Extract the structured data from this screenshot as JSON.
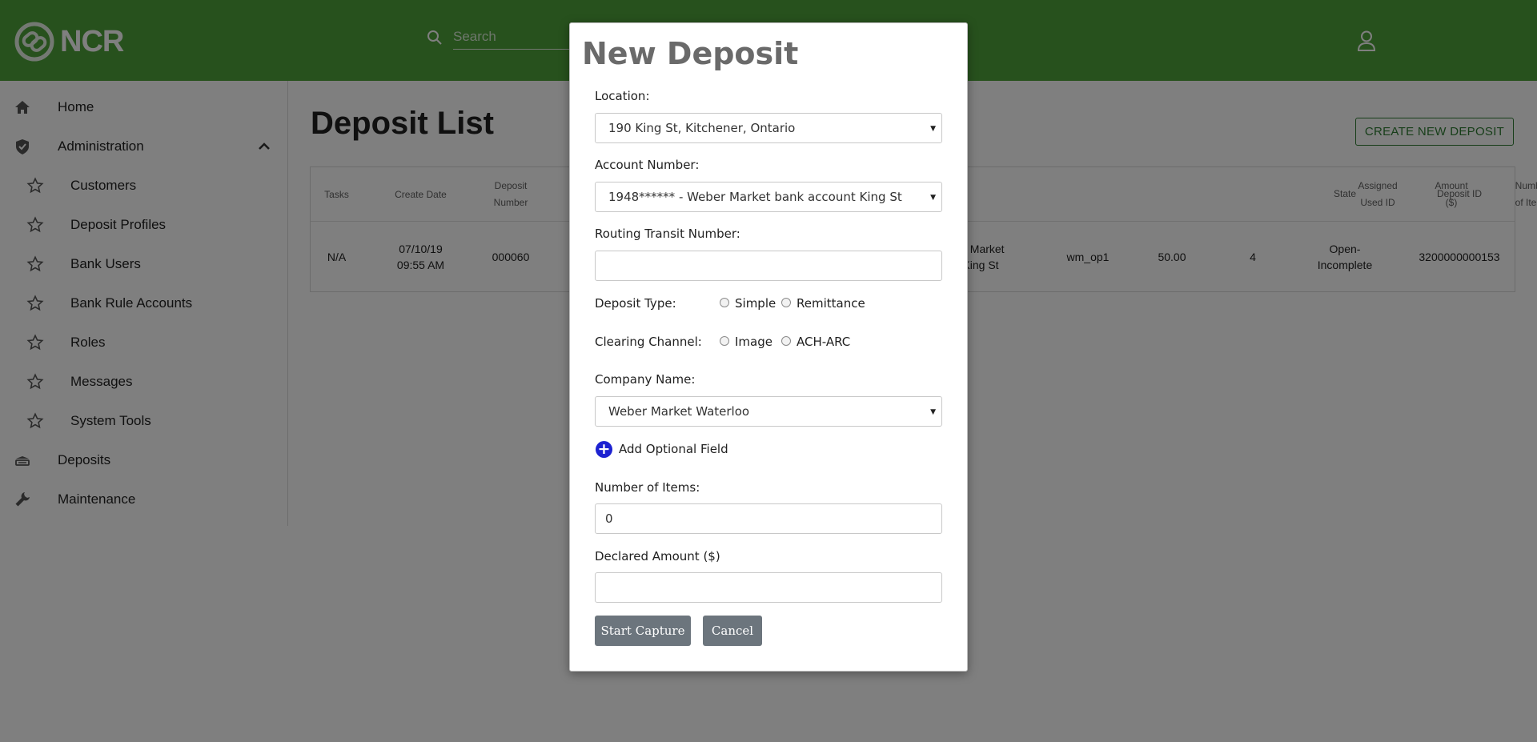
{
  "header": {
    "brand": "NCR",
    "search_placeholder": "Search"
  },
  "sidebar": {
    "items": [
      {
        "label": "Home",
        "icon": "home-icon"
      },
      {
        "label": "Administration",
        "icon": "shield-icon"
      },
      {
        "label": "Customers",
        "icon": "star-icon"
      },
      {
        "label": "Deposit Profiles",
        "icon": "star-icon"
      },
      {
        "label": "Bank Users",
        "icon": "star-icon"
      },
      {
        "label": "Bank Rule Accounts",
        "icon": "star-icon"
      },
      {
        "label": "Roles",
        "icon": "star-icon"
      },
      {
        "label": "Messages",
        "icon": "star-icon"
      },
      {
        "label": "System Tools",
        "icon": "star-icon"
      },
      {
        "label": "Deposits",
        "icon": "deposit-icon"
      },
      {
        "label": "Maintenance",
        "icon": "wrench-icon"
      }
    ]
  },
  "main": {
    "title": "Deposit List",
    "create_label": "CREATE NEW DEPOSIT",
    "table": {
      "headers": [
        "Tasks",
        "Create Date",
        "Deposit Number",
        "Assigned Used ID",
        "Amount ($)",
        "Number of Items",
        "State",
        "Deposit ID"
      ],
      "header_lines": {
        "deposit_number": [
          "Deposit",
          "Number"
        ],
        "assigned": [
          "Assigned",
          "Used ID"
        ],
        "amount": [
          "Amount",
          "($)"
        ],
        "items": [
          "Number",
          "of Items"
        ]
      },
      "row": {
        "tasks": "N/A",
        "date_line1": "07/10/19",
        "date_line2": "09:55 AM",
        "deposit_number": "000060",
        "name_line1": "er Market",
        "name_line2": "King St",
        "assigned": "wm_op1",
        "amount": "50.00",
        "items": "4",
        "state_line1": "Open-",
        "state_line2": "Incomplete",
        "deposit_id": "3200000000153"
      }
    }
  },
  "modal": {
    "title": "New Deposit",
    "location_label": "Location:",
    "location_value": "190 King St, Kitchener, Ontario",
    "account_label": "Account Number:",
    "account_value": "1948****** - Weber Market bank account King St",
    "routing_label": "Routing Transit Number:",
    "routing_value": "",
    "deposit_type_label": "Deposit Type:",
    "deposit_type_options": [
      "Simple",
      "Remittance"
    ],
    "clearing_label": "Clearing Channel:",
    "clearing_options": [
      "Image",
      "ACH-ARC"
    ],
    "company_label": "Company Name:",
    "company_value": "Weber Market Waterloo",
    "add_optional_label": "Add Optional Field",
    "items_label": "Number of Items:",
    "items_value": "0",
    "amount_label": "Declared Amount ($)",
    "amount_value": "",
    "start_label": "Start Capture",
    "cancel_label": "Cancel"
  },
  "colors": {
    "header_green": "#4ea33b",
    "button_gray": "#6c757d",
    "add_blue": "#1d22d1"
  }
}
